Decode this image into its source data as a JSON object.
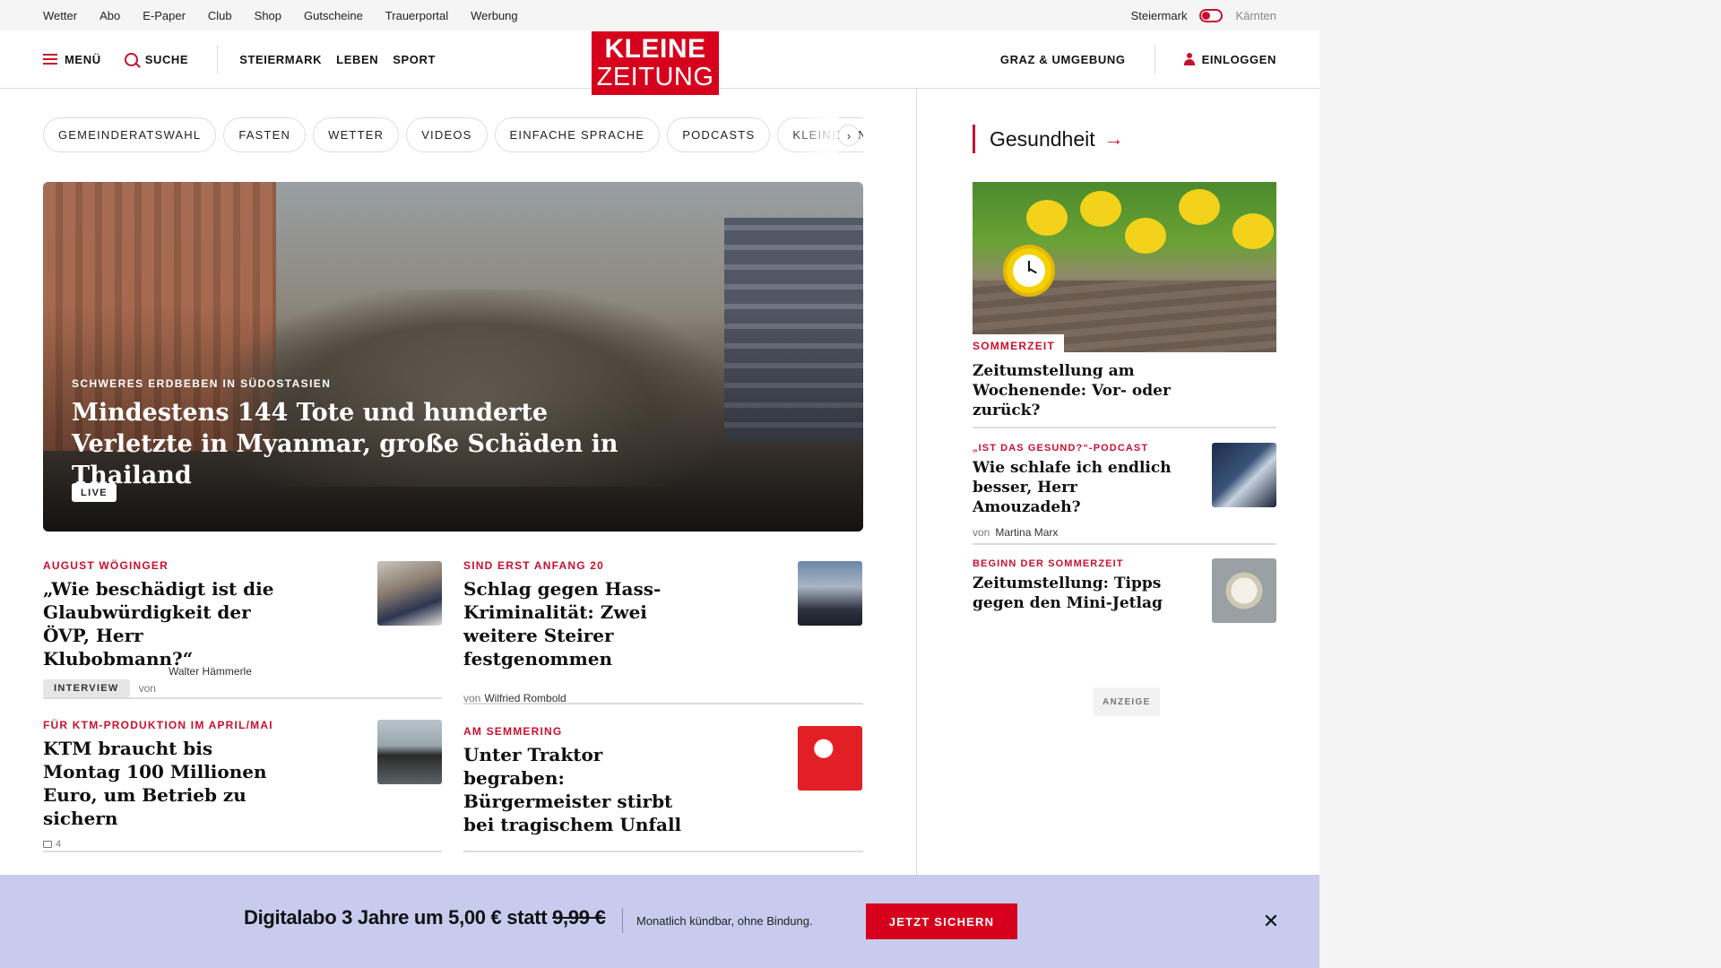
{
  "topbar": {
    "links": [
      "Wetter",
      "Abo",
      "E-Paper",
      "Club",
      "Shop",
      "Gutscheine",
      "Trauerportal",
      "Werbung"
    ],
    "region_active": "Steiermark",
    "region_inactive": "Kärnten"
  },
  "header": {
    "menu_label": "MENÜ",
    "search_label": "SUCHE",
    "nav": [
      "STEIERMARK",
      "LEBEN",
      "SPORT"
    ],
    "logo_line1": "KLEINE",
    "logo_line2": "ZEITUNG",
    "local_label": "GRAZ & UMGEBUNG",
    "login_label": "EINLOGGEN"
  },
  "pills": [
    "GEMEINDERATSWAHL",
    "FASTEN",
    "WETTER",
    "VIDEOS",
    "EINFACHE SPRACHE",
    "PODCASTS",
    "KLEINE KINDER"
  ],
  "hero": {
    "kicker": "SCHWERES ERDBEBEN IN SÜDOSTASIEN",
    "title": "Mindestens 144 Tote und hunderte Verletzte in Myanmar, große Schäden in Thailand",
    "badge": "LIVE"
  },
  "teasers": [
    {
      "kicker": "AUGUST WÖGINGER",
      "title": "„Wie beschädigt ist die Glaubwürdigkeit der ÖVP, Herr Klubobmann?“",
      "tag": "INTERVIEW",
      "by": "von",
      "author": "Walter Hämmerle"
    },
    {
      "kicker": "SIND ERST ANFANG 20",
      "title": "Schlag gegen Hass-Kriminalität: Zwei weitere Steirer festgenommen",
      "by": "von",
      "author": "Wilfried Rombold"
    },
    {
      "kicker": "FÜR KTM-PRODUKTION IM APRIL/MAI",
      "title": "KTM braucht bis Montag 100 Millionen Euro, um Betrieb zu sichern",
      "comments": "4"
    },
    {
      "kicker": "AM SEMMERING",
      "title": "Unter Traktor begraben: Bürgermeister stirbt bei tragischem Unfall"
    }
  ],
  "sidebar": {
    "section_title": "Gesundheit",
    "featured": {
      "kicker": "SOMMERZEIT",
      "title": "Zeitumstellung am Wochenende: Vor- oder zurück?"
    },
    "items": [
      {
        "kicker": "„IST DAS GESUND?“-PODCAST",
        "title": "Wie schlafe ich endlich besser, Herr Amouzadeh?",
        "by": "von",
        "author": "Martina Marx"
      },
      {
        "kicker": "BEGINN DER SOMMERZEIT",
        "title": "Zeitumstellung: Tipps gegen den Mini-Jetlag"
      }
    ],
    "ad_label": "ANZEIGE"
  },
  "promo": {
    "headline_main": "Digitalabo 3 Jahre um 5,00 € statt",
    "headline_strike": "9,99 €",
    "sub": "Monatlich kündbar, ohne Bindung.",
    "button": "JETZT SICHERN"
  },
  "colors": {
    "brand_red": "#d6001c",
    "accent_red": "#c8102e",
    "promo_bg": "#c7ccef"
  }
}
